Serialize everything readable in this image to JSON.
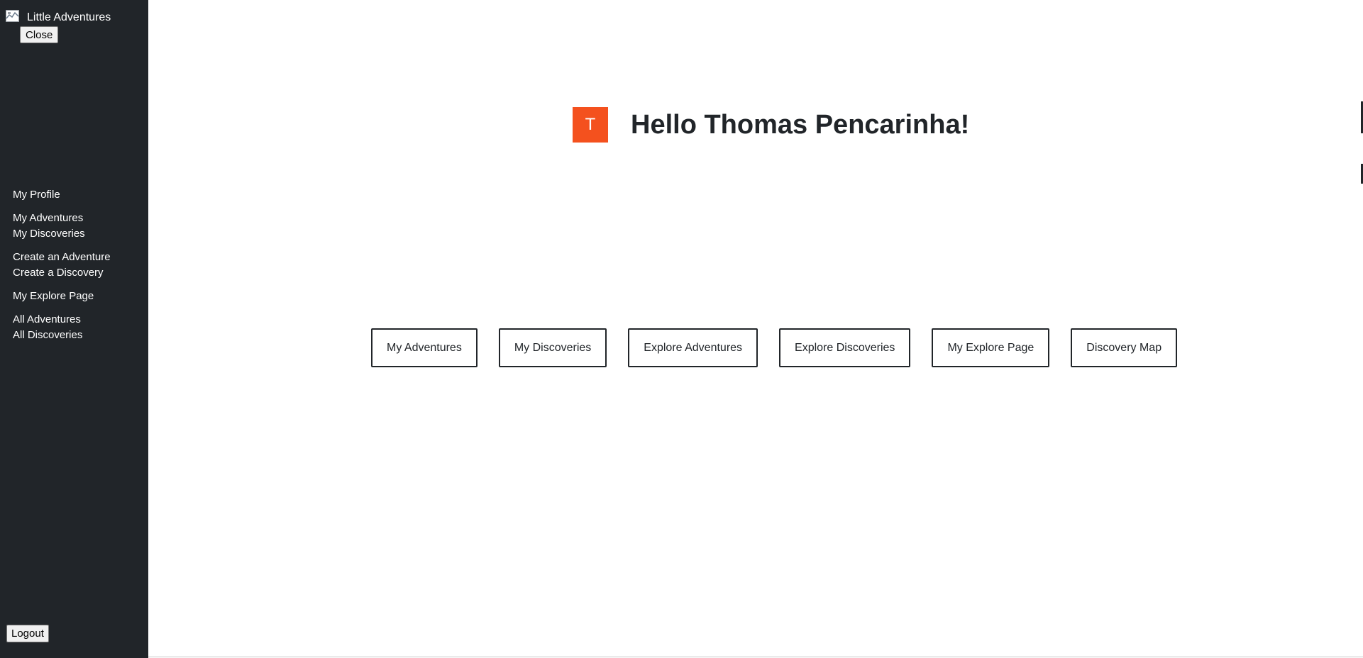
{
  "sidebar": {
    "brand": {
      "icon": "map-icon",
      "title": "Little Adventures"
    },
    "close_label": "Close",
    "nav_groups": [
      {
        "items": [
          {
            "label": "My Profile"
          }
        ]
      },
      {
        "items": [
          {
            "label": "My Adventures"
          },
          {
            "label": "My Discoveries"
          }
        ]
      },
      {
        "items": [
          {
            "label": "Create an Adventure"
          },
          {
            "label": "Create a Discovery"
          }
        ]
      },
      {
        "items": [
          {
            "label": "My Explore Page"
          }
        ]
      },
      {
        "items": [
          {
            "label": "All Adventures"
          },
          {
            "label": "All Discoveries"
          }
        ]
      }
    ],
    "logout_label": "Logout"
  },
  "main": {
    "avatar": {
      "initial": "T",
      "color": "#f4511e"
    },
    "greeting": "Hello Thomas Pencarinha!",
    "actions": [
      {
        "label": "My Adventures"
      },
      {
        "label": "My Discoveries"
      },
      {
        "label": "Explore Adventures"
      },
      {
        "label": "Explore Discoveries"
      },
      {
        "label": "My Explore Page"
      },
      {
        "label": "Discovery Map"
      }
    ]
  },
  "colors": {
    "sidebar_bg": "#212529",
    "accent": "#f4511e",
    "text_dark": "#212529"
  }
}
